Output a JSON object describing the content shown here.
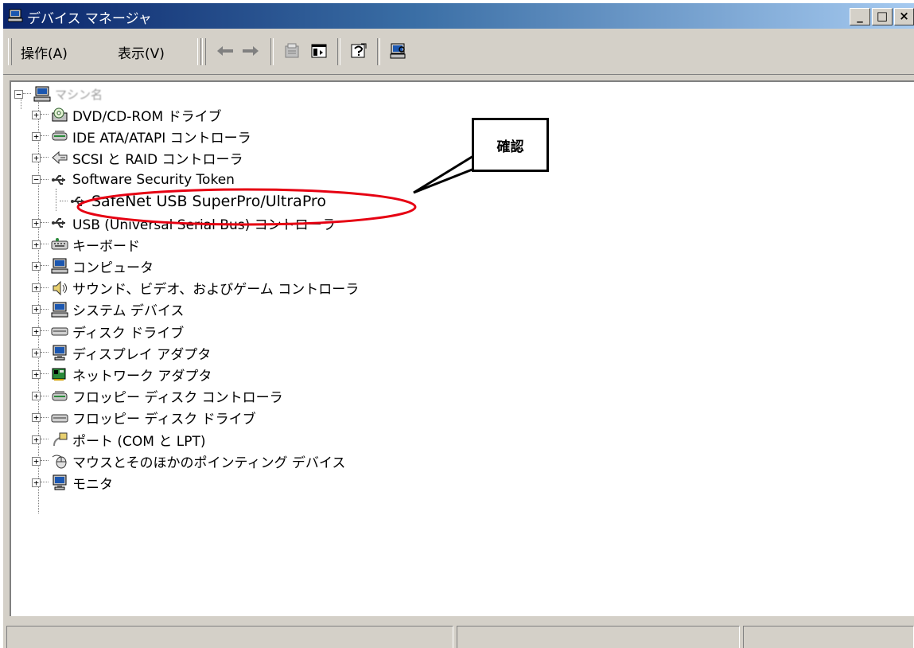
{
  "window": {
    "title": "デバイス マネージャ",
    "caption_buttons": [
      "_",
      "□",
      "×"
    ]
  },
  "menu": {
    "action": "操作(A)",
    "view": "表示(V)"
  },
  "toolbar_icons": [
    "back-arrow-icon",
    "forward-arrow-icon",
    "properties-icon",
    "show-hide-tree-icon",
    "help-icon",
    "scan-hardware-icon"
  ],
  "tree": {
    "root": "マシン名",
    "items": [
      {
        "label": "DVD/CD-ROM ドライブ",
        "icon": "cdrom-icon"
      },
      {
        "label": "IDE ATA/ATAPI コントローラ",
        "icon": "ide-controller-icon"
      },
      {
        "label": "SCSI と RAID コントローラ",
        "icon": "scsi-icon"
      },
      {
        "label": "Software Security Token",
        "icon": "usb-icon",
        "expanded": true,
        "children": [
          {
            "label": "SafeNet USB SuperPro/UltraPro",
            "icon": "usb-icon"
          }
        ]
      },
      {
        "label": "USB (Universal Serial Bus) コントローラ",
        "icon": "usb-icon"
      },
      {
        "label": "キーボード",
        "icon": "keyboard-icon"
      },
      {
        "label": "コンピュータ",
        "icon": "computer-icon"
      },
      {
        "label": "サウンド、ビデオ、およびゲーム コントローラ",
        "icon": "speaker-icon"
      },
      {
        "label": "システム デバイス",
        "icon": "computer-icon"
      },
      {
        "label": "ディスク ドライブ",
        "icon": "disk-drive-icon"
      },
      {
        "label": "ディスプレイ アダプタ",
        "icon": "monitor-icon"
      },
      {
        "label": "ネットワーク アダプタ",
        "icon": "network-card-icon"
      },
      {
        "label": "フロッピー ディスク コントローラ",
        "icon": "ide-controller-icon"
      },
      {
        "label": "フロッピー ディスク ドライブ",
        "icon": "disk-drive-icon"
      },
      {
        "label": "ポート (COM と LPT)",
        "icon": "port-icon"
      },
      {
        "label": "マウスとそのほかのポインティング デバイス",
        "icon": "mouse-icon"
      },
      {
        "label": "モニタ",
        "icon": "monitor-icon"
      }
    ]
  },
  "annotation": {
    "callout_text": "確認",
    "highlight_color": "#e60012"
  },
  "colors": {
    "title_start": "#0a246a",
    "title_end": "#a6caf0",
    "chrome": "#d4d0c8"
  }
}
